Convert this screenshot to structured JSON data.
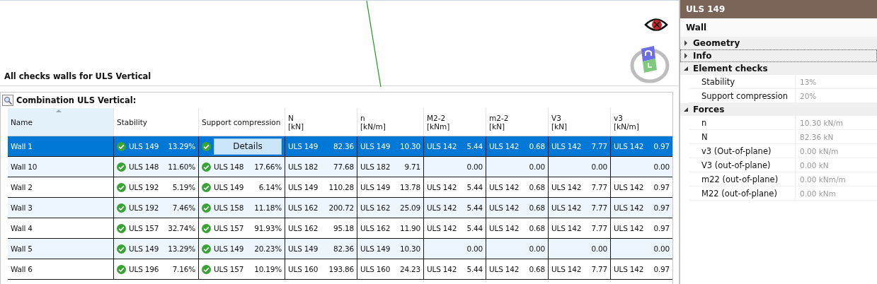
{
  "viewport": {
    "caption": "All checks walls for ULS Vertical"
  },
  "table": {
    "title": "Combination ULS Vertical:",
    "columns": [
      {
        "label": "Name",
        "sorted": true
      },
      {
        "label": "Stability",
        "sorted": false
      },
      {
        "label": "Support compression",
        "sorted": false
      },
      {
        "label": "N",
        "unit": "[kN]",
        "sorted": false
      },
      {
        "label": "n",
        "unit": "[kN/m]",
        "sorted": false
      },
      {
        "label": "M2-2",
        "unit": "[kNm]",
        "sorted": false
      },
      {
        "label": "m2-2",
        "unit": "[kN]",
        "sorted": false
      },
      {
        "label": "V3",
        "unit": "[kN]",
        "sorted": false
      },
      {
        "label": "v3",
        "unit": "[kN/m]",
        "sorted": false
      }
    ],
    "rows": [
      {
        "name": "Wall 1",
        "selected": true,
        "stability": {
          "combo": "ULS 149",
          "value": "13.29%"
        },
        "support": {
          "kind": "button",
          "button": "Details"
        },
        "forces": [
          {
            "combo": "ULS 149",
            "value": "82.36"
          },
          {
            "combo": "ULS 149",
            "value": "10.30"
          },
          {
            "combo": "ULS 142",
            "value": "5.44"
          },
          {
            "combo": "ULS 142",
            "value": "0.68"
          },
          {
            "combo": "ULS 142",
            "value": "7.77"
          },
          {
            "combo": "ULS 142",
            "value": "0.97"
          }
        ]
      },
      {
        "name": "Wall 10",
        "selected": false,
        "stability": {
          "combo": "ULS 148",
          "value": "11.60%"
        },
        "support": {
          "kind": "value",
          "combo": "ULS 148",
          "value": "17.66%"
        },
        "forces": [
          {
            "combo": "ULS 182",
            "value": "77.68"
          },
          {
            "combo": "ULS 182",
            "value": "9.71"
          },
          {
            "value": "0.00"
          },
          {
            "value": "0.00"
          },
          {
            "value": "0.00"
          },
          {
            "value": "0.00"
          }
        ]
      },
      {
        "name": "Wall 2",
        "selected": false,
        "stability": {
          "combo": "ULS 192",
          "value": "5.19%"
        },
        "support": {
          "kind": "value",
          "combo": "ULS 149",
          "value": "6.14%"
        },
        "forces": [
          {
            "combo": "ULS 149",
            "value": "110.28"
          },
          {
            "combo": "ULS 149",
            "value": "13.78"
          },
          {
            "combo": "ULS 142",
            "value": "5.44"
          },
          {
            "combo": "ULS 142",
            "value": "0.68"
          },
          {
            "combo": "ULS 142",
            "value": "7.77"
          },
          {
            "combo": "ULS 142",
            "value": "0.97"
          }
        ]
      },
      {
        "name": "Wall 3",
        "selected": false,
        "stability": {
          "combo": "ULS 192",
          "value": "7.46%"
        },
        "support": {
          "kind": "value",
          "combo": "ULS 158",
          "value": "11.18%"
        },
        "forces": [
          {
            "combo": "ULS 162",
            "value": "200.72"
          },
          {
            "combo": "ULS 162",
            "value": "25.09"
          },
          {
            "combo": "ULS 142",
            "value": "5.44"
          },
          {
            "combo": "ULS 142",
            "value": "0.68"
          },
          {
            "combo": "ULS 142",
            "value": "7.77"
          },
          {
            "combo": "ULS 142",
            "value": "0.97"
          }
        ]
      },
      {
        "name": "Wall 4",
        "selected": false,
        "stability": {
          "combo": "ULS 157",
          "value": "32.74%"
        },
        "support": {
          "kind": "value",
          "combo": "ULS 157",
          "value": "91.93%"
        },
        "forces": [
          {
            "combo": "ULS 162",
            "value": "95.18"
          },
          {
            "combo": "ULS 162",
            "value": "11.90"
          },
          {
            "combo": "ULS 142",
            "value": "5.44"
          },
          {
            "combo": "ULS 142",
            "value": "0.68"
          },
          {
            "combo": "ULS 142",
            "value": "7.77"
          },
          {
            "combo": "ULS 142",
            "value": "0.97"
          }
        ]
      },
      {
        "name": "Wall 5",
        "selected": false,
        "stability": {
          "combo": "ULS 149",
          "value": "13.29%"
        },
        "support": {
          "kind": "value",
          "combo": "ULS 149",
          "value": "20.23%"
        },
        "forces": [
          {
            "combo": "ULS 149",
            "value": "82.36"
          },
          {
            "combo": "ULS 149",
            "value": "10.30"
          },
          {
            "value": "0.00"
          },
          {
            "value": "0.00"
          },
          {
            "value": "0.00"
          },
          {
            "value": "0.00"
          }
        ]
      },
      {
        "name": "Wall 6",
        "selected": false,
        "stability": {
          "combo": "ULS 196",
          "value": "7.16%"
        },
        "support": {
          "kind": "value",
          "combo": "ULS 157",
          "value": "10.19%"
        },
        "forces": [
          {
            "combo": "ULS 160",
            "value": "193.86"
          },
          {
            "combo": "ULS 160",
            "value": "24.23"
          },
          {
            "combo": "ULS 142",
            "value": "5.44"
          },
          {
            "combo": "ULS 142",
            "value": "0.68"
          },
          {
            "combo": "ULS 142",
            "value": "7.77"
          },
          {
            "combo": "ULS 142",
            "value": "0.97"
          }
        ]
      }
    ]
  },
  "properties": {
    "title": "ULS 149",
    "subtitle": "Wall",
    "groups": [
      {
        "label": "Geometry",
        "expanded": false,
        "focused": false
      },
      {
        "label": "Info",
        "expanded": false,
        "focused": true
      },
      {
        "label": "Element checks",
        "expanded": true,
        "focused": false,
        "items": [
          {
            "name": "Stability",
            "value": "13%"
          },
          {
            "name": "Support compression",
            "value": "20%"
          }
        ]
      },
      {
        "label": "Forces",
        "expanded": true,
        "focused": false,
        "items": [
          {
            "name": "n",
            "value": "10.30 kN/m"
          },
          {
            "name": "N",
            "value": "82.36 kN"
          },
          {
            "name": "v3 (Out-of-plane)",
            "value": "0.00 kN/m"
          },
          {
            "name": "V3 (out-of-plane)",
            "value": "0.00 kN"
          },
          {
            "name": "m22 (out-of-plane)",
            "value": "0.00 kNm/m"
          },
          {
            "name": "M22 (out-of-plane)",
            "value": "0.00 kNm"
          }
        ]
      }
    ]
  }
}
